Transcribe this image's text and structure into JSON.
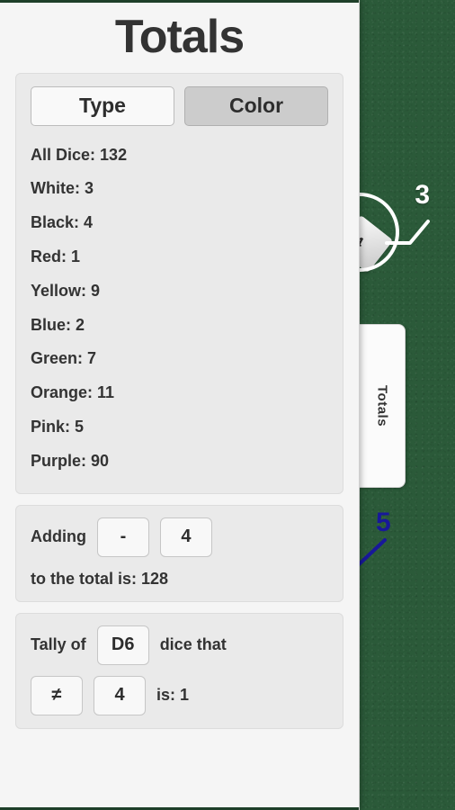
{
  "background": {
    "felt_color": "#2b5a39"
  },
  "annotations": [
    {
      "id": "die-callout-3",
      "value": "3",
      "color": "#ffffff",
      "die_face": "4"
    },
    {
      "id": "die-callout-5",
      "value": "5",
      "color": "#18189a"
    }
  ],
  "side_tab": {
    "label": "Totals"
  },
  "panel": {
    "title": "Totals",
    "mode_toggle": {
      "options": [
        {
          "label": "Type",
          "active": false
        },
        {
          "label": "Color",
          "active": true
        }
      ]
    },
    "totals": [
      {
        "label": "All Dice:",
        "value": "132"
      },
      {
        "label": "White:",
        "value": "3"
      },
      {
        "label": "Black:",
        "value": "4"
      },
      {
        "label": "Red:",
        "value": "1"
      },
      {
        "label": "Yellow:",
        "value": "9"
      },
      {
        "label": "Blue:",
        "value": "2"
      },
      {
        "label": "Green:",
        "value": "7"
      },
      {
        "label": "Orange:",
        "value": "11"
      },
      {
        "label": "Pink:",
        "value": "5"
      },
      {
        "label": "Purple:",
        "value": "90"
      }
    ],
    "adding": {
      "prefix": "Adding",
      "operator": "-",
      "operand": "4",
      "result_text": "to the total is: 128"
    },
    "tally": {
      "prefix": "Tally of",
      "dice_type": "D6",
      "middle_text": "dice that",
      "comparator": "≠",
      "target": "4",
      "result_text": "is: 1"
    }
  }
}
